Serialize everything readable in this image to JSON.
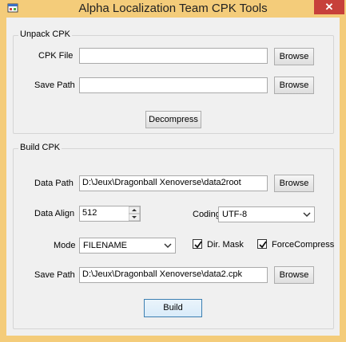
{
  "window": {
    "title": "Alpha Localization Team CPK Tools",
    "close_glyph": "✕"
  },
  "unpack": {
    "group_label": "Unpack CPK",
    "cpk_file_label": "CPK File",
    "cpk_file_value": "",
    "browse1_label": "Browse",
    "save_path_label": "Save Path",
    "save_path_value": "",
    "browse2_label": "Browse",
    "decompress_label": "Decompress"
  },
  "build": {
    "group_label": "Build CPK",
    "data_path_label": "Data Path",
    "data_path_value": "D:\\Jeux\\Dragonball Xenoverse\\data2root",
    "browse3_label": "Browse",
    "data_align_label": "Data Align",
    "data_align_value": "512",
    "coding_label": "Coding",
    "coding_value": "UTF-8",
    "mode_label": "Mode",
    "mode_value": "FILENAME",
    "dir_mask_label": "Dir. Mask",
    "dir_mask_checked": true,
    "force_compress_label": "ForceCompress",
    "force_compress_checked": true,
    "save_path_label": "Save Path",
    "save_path_value": "D:\\Jeux\\Dragonball Xenoverse\\data2.cpk",
    "browse4_label": "Browse",
    "build_label": "Build"
  },
  "icons": {
    "app": "app-icon",
    "dropdown": "chevron-down-icon",
    "spin": "spin-updown-icon",
    "check": "checkmark-icon"
  }
}
